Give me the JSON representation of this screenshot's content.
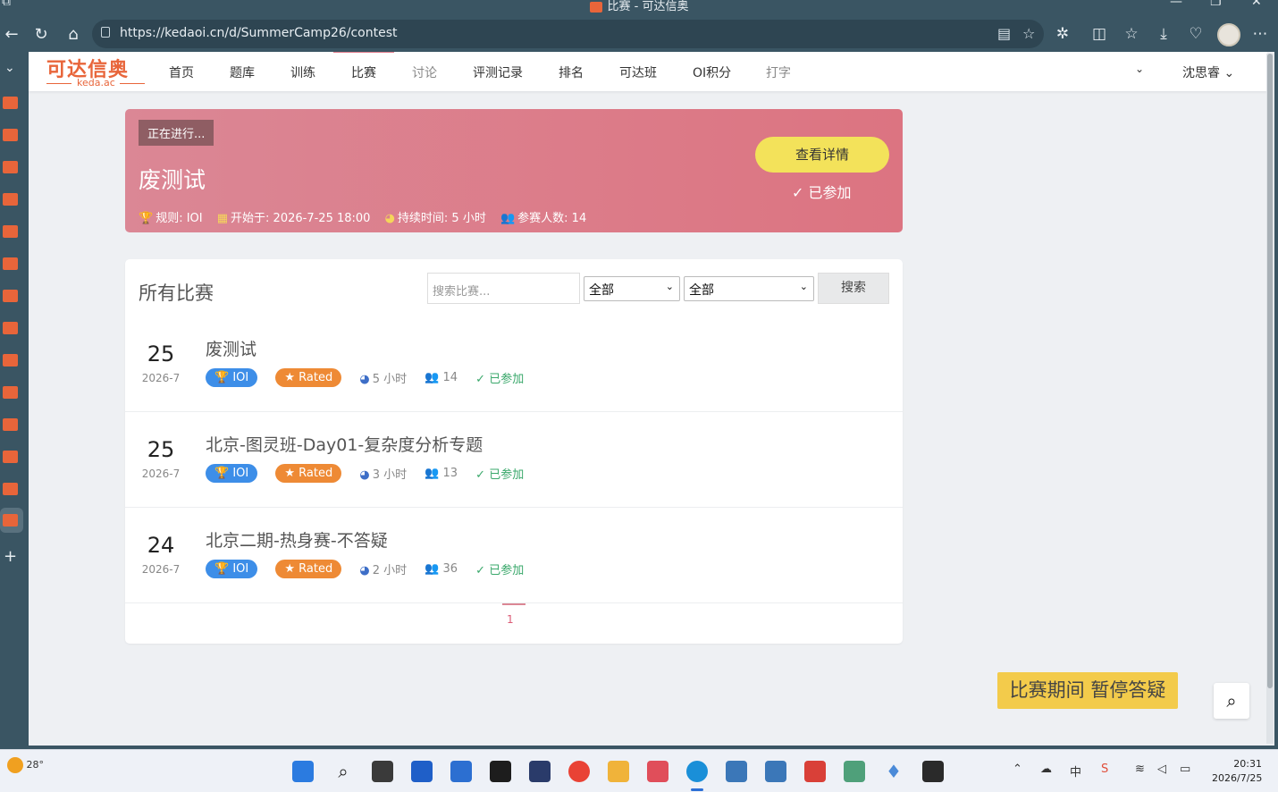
{
  "browser": {
    "window_title": "比赛 - 可达信奥",
    "url": "https://kedaoi.cn/d/SummerCamp26/contest"
  },
  "site": {
    "logo_cn": "可达信奥",
    "logo_en": "keda.ac",
    "nav": [
      "首页",
      "题库",
      "训练",
      "比赛",
      "讨论",
      "评测记录",
      "排名",
      "可达班",
      "OI积分",
      "打字"
    ],
    "active_nav": "比赛",
    "user": "沈思睿"
  },
  "featured": {
    "status": "正在进行...",
    "name": "废测试",
    "rule": "规则: IOI",
    "start": "开始于: 2026-7-25 18:00",
    "duration": "持续时间: 5 小时",
    "participants": "参赛人数: 14",
    "detail_button": "查看详情",
    "joined": "已参加"
  },
  "list": {
    "heading": "所有比赛",
    "search_placeholder": "搜索比赛...",
    "filter1": "全部",
    "filter2": "全部",
    "search_button": "搜索",
    "contests": [
      {
        "day": "25",
        "ym": "2026-7",
        "title": "废测试",
        "rule": "IOI",
        "rated": "Rated",
        "duration": "5 小时",
        "count": "14",
        "status": "已参加"
      },
      {
        "day": "25",
        "ym": "2026-7",
        "title": "北京-图灵班-Day01-复杂度分析专题",
        "rule": "IOI",
        "rated": "Rated",
        "duration": "3 小时",
        "count": "13",
        "status": "已参加"
      },
      {
        "day": "24",
        "ym": "2026-7",
        "title": "北京二期-热身赛-不答疑",
        "rule": "IOI",
        "rated": "Rated",
        "duration": "2 小时",
        "count": "36",
        "status": "已参加"
      }
    ],
    "page": "1"
  },
  "notice": "比赛期间 暂停答疑",
  "taskbar": {
    "weather": "28°",
    "tray_ime": "中",
    "time": "20:31",
    "date": "2026/7/25"
  },
  "colors": {
    "brand": "#e8653a",
    "hero_start": "#db8795",
    "hero_end": "#dc7481",
    "ioi": "#3d8ee8",
    "rated": "#ee8a35",
    "joined": "#3aa86b",
    "notice": "#f3cb4b"
  }
}
